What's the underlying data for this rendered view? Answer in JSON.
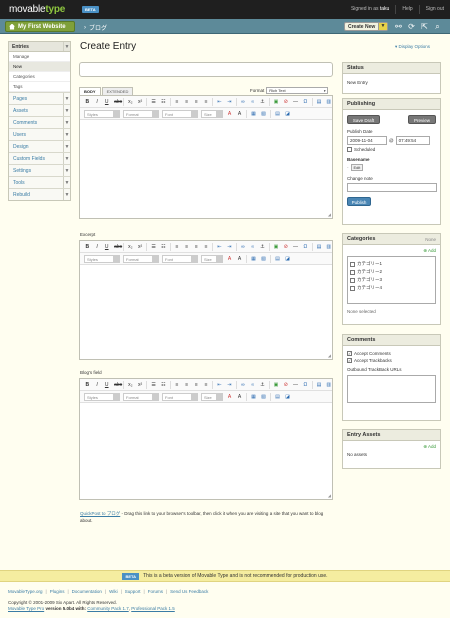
{
  "header": {
    "logo_prefix": "movable",
    "logo_suffix": "type",
    "badge": "BETA",
    "signed_in_as": "Signed in as",
    "username": "taku",
    "help": "Help",
    "sign_out": "Sign out"
  },
  "bluebar": {
    "site_button": "My First Website",
    "blog_name": "ブログ",
    "create_new": "Create New"
  },
  "sidebar": {
    "head": "Entries",
    "subitems": [
      "Manage",
      "New",
      "Categories",
      "Tags"
    ],
    "items": [
      "Pages",
      "Assets",
      "Comments",
      "Users",
      "Design",
      "Custom Fields",
      "Settings",
      "Tools",
      "Rebuild"
    ]
  },
  "main": {
    "title": "Create Entry",
    "display_options": "Display Options",
    "tabs": [
      "BODY",
      "EXTENDED"
    ],
    "format_label": "Format",
    "format_value": "Rich Text",
    "excerpt_label": "Excerpt",
    "blogs_field_label": "Blog's field",
    "toolbar_dropdowns": [
      "Styles",
      "Format",
      "Font",
      "Size"
    ],
    "quickpost_link": "QuickPost to ブログ",
    "quickpost_text": " - Drag this link to your browser's toolbar, then click it when you are visiting a site that you want to blog about."
  },
  "status_panel": {
    "title": "Status",
    "value": "New Entry"
  },
  "publishing": {
    "title": "Publishing",
    "save_draft": "Save Draft",
    "preview": "Preview",
    "publish_date_label": "Publish Date",
    "date": "2009-11-04",
    "at": "@",
    "time": "07:49:54",
    "scheduled": "Scheduled",
    "basename_label": "Basename",
    "basename_edit": "Edit",
    "change_note_label": "Change note",
    "publish": "Publish"
  },
  "categories": {
    "title": "Categories",
    "none": "None",
    "add": "Add",
    "items": [
      "カテゴリー1",
      "カテゴリー2",
      "カテゴリー3",
      "カテゴリー4"
    ],
    "none_selected": "None selected"
  },
  "comments": {
    "title": "Comments",
    "accept_comments": "Accept Comments",
    "accept_trackbacks": "Accept Trackbacks",
    "outbound_label": "Outbound TrackBack URLs"
  },
  "entry_assets": {
    "title": "Entry Assets",
    "add": "Add",
    "empty": "No assets"
  },
  "footer": {
    "beta_badge": "BETA",
    "notice": "This is a beta version of Movable Type and is not recommended for production use.",
    "links": [
      "MovableType.org",
      "Plugins",
      "Documentation",
      "Wiki",
      "Support",
      "Forums",
      "Send Us Feedback"
    ],
    "copyright": "Copyright © 2001-2009 Six Apart. All Rights Reserved.",
    "version_link": "Movable Type Pro",
    "version_text": " version 5.0b4 with: ",
    "pack1": "Community Pack 1.7",
    "pack2": "Professional Pack 1.5"
  }
}
